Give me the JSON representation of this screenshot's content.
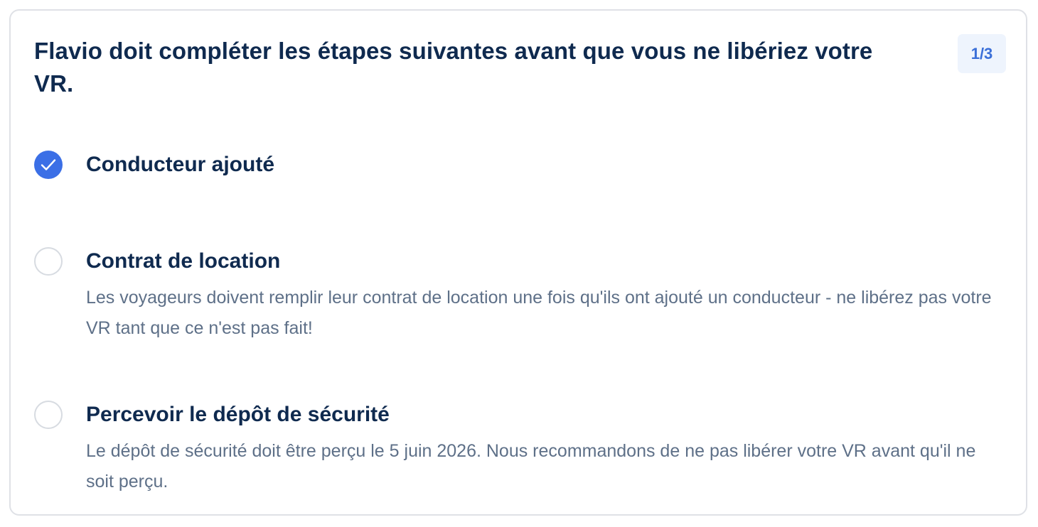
{
  "card": {
    "title": "Flavio doit compléter les étapes suivantes avant que vous ne libériez votre VR.",
    "counter": "1/3"
  },
  "steps": [
    {
      "label": "Conducteur ajouté",
      "status": "done",
      "icon": "check-icon",
      "description": ""
    },
    {
      "label": "Contrat de location",
      "status": "todo",
      "icon": "empty-circle-icon",
      "description": "Les voyageurs doivent remplir leur contrat de location une fois qu'ils ont ajouté un conducteur - ne libérez pas votre VR tant que ce n'est pas fait!"
    },
    {
      "label": "Percevoir le dépôt de sécurité",
      "status": "todo",
      "icon": "empty-circle-icon",
      "description": "Le dépôt de sécurité doit être perçu le 5 juin 2026. Nous recommandons de ne pas libérer votre VR avant qu'il ne soit perçu."
    }
  ],
  "colors": {
    "heading": "#0f2a4f",
    "body_text": "#5e7088",
    "accent": "#3b6fe6",
    "counter_text": "#3a6fd8",
    "counter_bg": "#eef4fd",
    "border": "#dfe1e6"
  }
}
